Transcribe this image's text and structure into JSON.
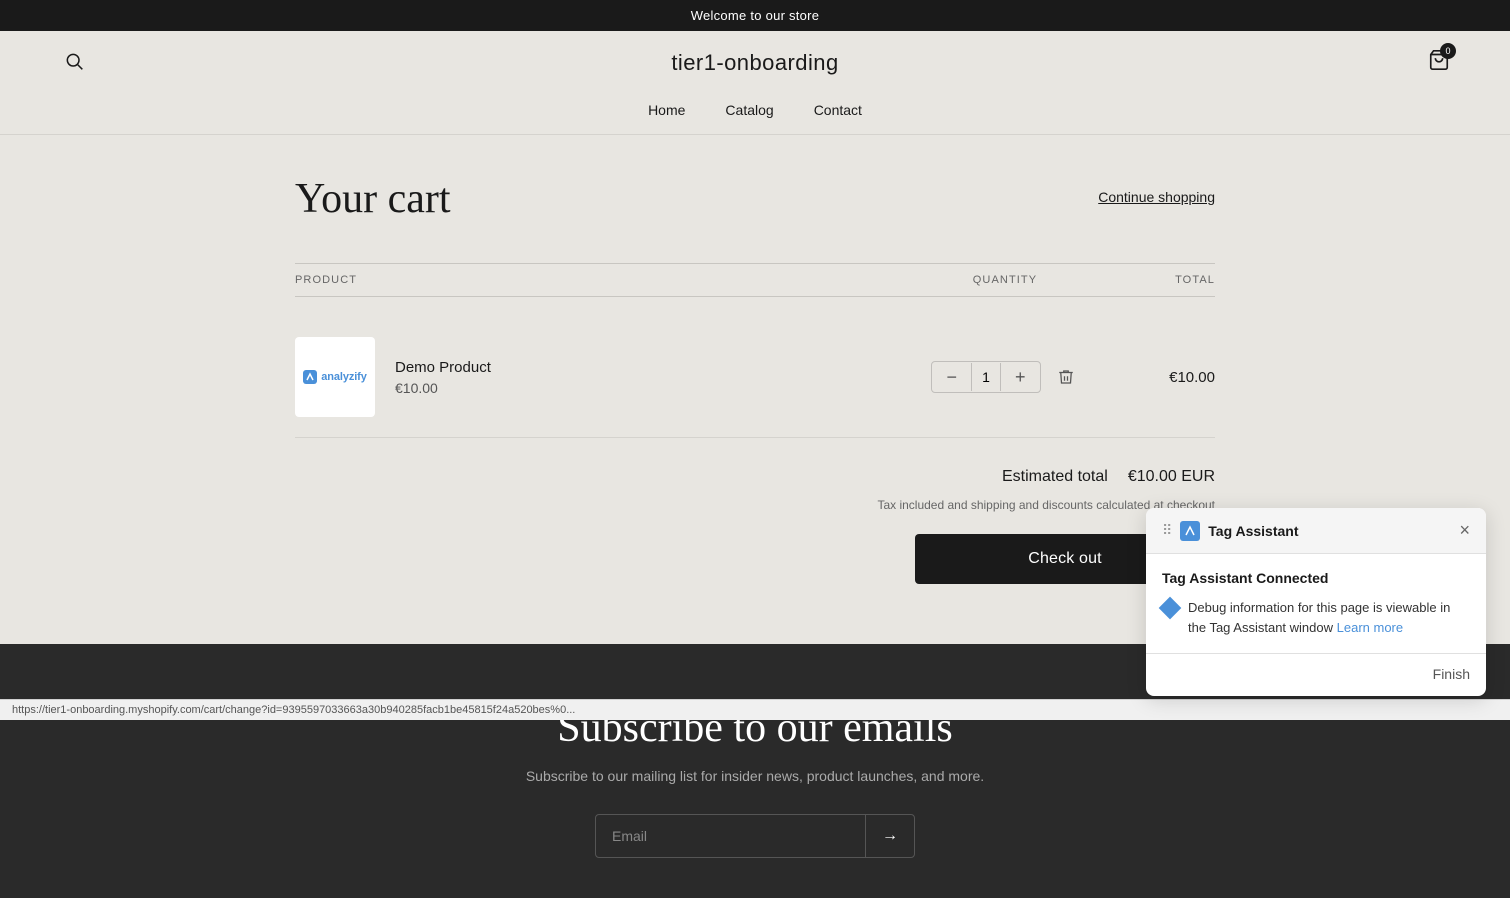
{
  "announcement": {
    "text": "Welcome to our store"
  },
  "header": {
    "logo": "tier1-onboarding",
    "cart_count": "0"
  },
  "nav": {
    "items": [
      {
        "label": "Home",
        "href": "#"
      },
      {
        "label": "Catalog",
        "href": "#"
      },
      {
        "label": "Contact",
        "href": "#"
      }
    ]
  },
  "cart": {
    "title": "Your cart",
    "continue_shopping": "Continue shopping",
    "table_headers": {
      "product": "PRODUCT",
      "quantity": "QUANTITY",
      "total": "TOTAL"
    },
    "items": [
      {
        "name": "Demo Product",
        "price": "€10.00",
        "quantity": 1,
        "total": "€10.00"
      }
    ],
    "estimated_total_label": "Estimated total",
    "estimated_total_amount": "€10.00 EUR",
    "tax_note": "Tax included and shipping and discounts calculated at checkout",
    "checkout_label": "Check out"
  },
  "footer": {
    "title": "Subscribe to our emails",
    "subtitle": "Subscribe to our mailing list for insider news, product launches, and more.",
    "email_placeholder": "Email",
    "submit_icon": "→"
  },
  "tag_assistant": {
    "title": "Tag Assistant",
    "status": "Tag Assistant Connected",
    "debug_text": "Debug information for this page is viewable in the Tag Assistant window",
    "learn_more": "Learn more",
    "finish_label": "Finish"
  },
  "status_bar": {
    "url": "https://tier1-onboarding.myshopify.com/cart/change?id=9395597033663a30b940285facb1be45815f24a520bes%0..."
  }
}
